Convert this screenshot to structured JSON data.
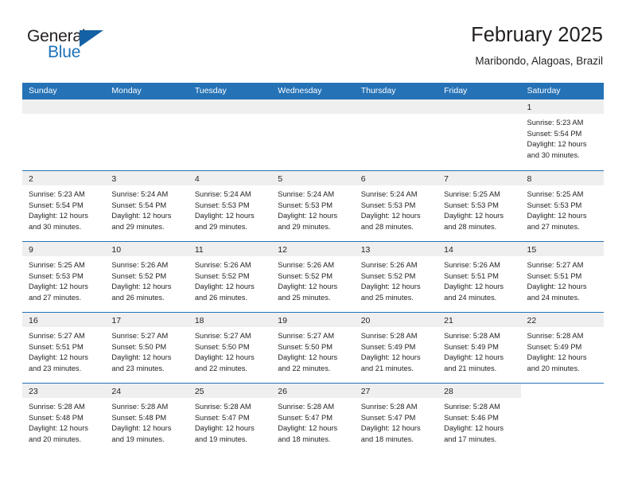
{
  "brand": {
    "name_part1": "General",
    "name_part2": "Blue"
  },
  "header": {
    "title": "February 2025",
    "location": "Maribondo, Alagoas, Brazil"
  },
  "weekdays": [
    "Sunday",
    "Monday",
    "Tuesday",
    "Wednesday",
    "Thursday",
    "Friday",
    "Saturday"
  ],
  "colors": {
    "header_blue": "#2572b6",
    "brand_blue": "#1f72b8",
    "daynum_band": "#efefef",
    "text": "#231f20"
  },
  "weeks": [
    [
      {
        "day": "",
        "lines": []
      },
      {
        "day": "",
        "lines": []
      },
      {
        "day": "",
        "lines": []
      },
      {
        "day": "",
        "lines": []
      },
      {
        "day": "",
        "lines": []
      },
      {
        "day": "",
        "lines": []
      },
      {
        "day": "1",
        "lines": [
          "Sunrise: 5:23 AM",
          "Sunset: 5:54 PM",
          "Daylight: 12 hours",
          "and 30 minutes."
        ]
      }
    ],
    [
      {
        "day": "2",
        "lines": [
          "Sunrise: 5:23 AM",
          "Sunset: 5:54 PM",
          "Daylight: 12 hours",
          "and 30 minutes."
        ]
      },
      {
        "day": "3",
        "lines": [
          "Sunrise: 5:24 AM",
          "Sunset: 5:54 PM",
          "Daylight: 12 hours",
          "and 29 minutes."
        ]
      },
      {
        "day": "4",
        "lines": [
          "Sunrise: 5:24 AM",
          "Sunset: 5:53 PM",
          "Daylight: 12 hours",
          "and 29 minutes."
        ]
      },
      {
        "day": "5",
        "lines": [
          "Sunrise: 5:24 AM",
          "Sunset: 5:53 PM",
          "Daylight: 12 hours",
          "and 29 minutes."
        ]
      },
      {
        "day": "6",
        "lines": [
          "Sunrise: 5:24 AM",
          "Sunset: 5:53 PM",
          "Daylight: 12 hours",
          "and 28 minutes."
        ]
      },
      {
        "day": "7",
        "lines": [
          "Sunrise: 5:25 AM",
          "Sunset: 5:53 PM",
          "Daylight: 12 hours",
          "and 28 minutes."
        ]
      },
      {
        "day": "8",
        "lines": [
          "Sunrise: 5:25 AM",
          "Sunset: 5:53 PM",
          "Daylight: 12 hours",
          "and 27 minutes."
        ]
      }
    ],
    [
      {
        "day": "9",
        "lines": [
          "Sunrise: 5:25 AM",
          "Sunset: 5:53 PM",
          "Daylight: 12 hours",
          "and 27 minutes."
        ]
      },
      {
        "day": "10",
        "lines": [
          "Sunrise: 5:26 AM",
          "Sunset: 5:52 PM",
          "Daylight: 12 hours",
          "and 26 minutes."
        ]
      },
      {
        "day": "11",
        "lines": [
          "Sunrise: 5:26 AM",
          "Sunset: 5:52 PM",
          "Daylight: 12 hours",
          "and 26 minutes."
        ]
      },
      {
        "day": "12",
        "lines": [
          "Sunrise: 5:26 AM",
          "Sunset: 5:52 PM",
          "Daylight: 12 hours",
          "and 25 minutes."
        ]
      },
      {
        "day": "13",
        "lines": [
          "Sunrise: 5:26 AM",
          "Sunset: 5:52 PM",
          "Daylight: 12 hours",
          "and 25 minutes."
        ]
      },
      {
        "day": "14",
        "lines": [
          "Sunrise: 5:26 AM",
          "Sunset: 5:51 PM",
          "Daylight: 12 hours",
          "and 24 minutes."
        ]
      },
      {
        "day": "15",
        "lines": [
          "Sunrise: 5:27 AM",
          "Sunset: 5:51 PM",
          "Daylight: 12 hours",
          "and 24 minutes."
        ]
      }
    ],
    [
      {
        "day": "16",
        "lines": [
          "Sunrise: 5:27 AM",
          "Sunset: 5:51 PM",
          "Daylight: 12 hours",
          "and 23 minutes."
        ]
      },
      {
        "day": "17",
        "lines": [
          "Sunrise: 5:27 AM",
          "Sunset: 5:50 PM",
          "Daylight: 12 hours",
          "and 23 minutes."
        ]
      },
      {
        "day": "18",
        "lines": [
          "Sunrise: 5:27 AM",
          "Sunset: 5:50 PM",
          "Daylight: 12 hours",
          "and 22 minutes."
        ]
      },
      {
        "day": "19",
        "lines": [
          "Sunrise: 5:27 AM",
          "Sunset: 5:50 PM",
          "Daylight: 12 hours",
          "and 22 minutes."
        ]
      },
      {
        "day": "20",
        "lines": [
          "Sunrise: 5:28 AM",
          "Sunset: 5:49 PM",
          "Daylight: 12 hours",
          "and 21 minutes."
        ]
      },
      {
        "day": "21",
        "lines": [
          "Sunrise: 5:28 AM",
          "Sunset: 5:49 PM",
          "Daylight: 12 hours",
          "and 21 minutes."
        ]
      },
      {
        "day": "22",
        "lines": [
          "Sunrise: 5:28 AM",
          "Sunset: 5:49 PM",
          "Daylight: 12 hours",
          "and 20 minutes."
        ]
      }
    ],
    [
      {
        "day": "23",
        "lines": [
          "Sunrise: 5:28 AM",
          "Sunset: 5:48 PM",
          "Daylight: 12 hours",
          "and 20 minutes."
        ]
      },
      {
        "day": "24",
        "lines": [
          "Sunrise: 5:28 AM",
          "Sunset: 5:48 PM",
          "Daylight: 12 hours",
          "and 19 minutes."
        ]
      },
      {
        "day": "25",
        "lines": [
          "Sunrise: 5:28 AM",
          "Sunset: 5:47 PM",
          "Daylight: 12 hours",
          "and 19 minutes."
        ]
      },
      {
        "day": "26",
        "lines": [
          "Sunrise: 5:28 AM",
          "Sunset: 5:47 PM",
          "Daylight: 12 hours",
          "and 18 minutes."
        ]
      },
      {
        "day": "27",
        "lines": [
          "Sunrise: 5:28 AM",
          "Sunset: 5:47 PM",
          "Daylight: 12 hours",
          "and 18 minutes."
        ]
      },
      {
        "day": "28",
        "lines": [
          "Sunrise: 5:28 AM",
          "Sunset: 5:46 PM",
          "Daylight: 12 hours",
          "and 17 minutes."
        ]
      },
      {
        "day": "",
        "lines": []
      }
    ]
  ]
}
